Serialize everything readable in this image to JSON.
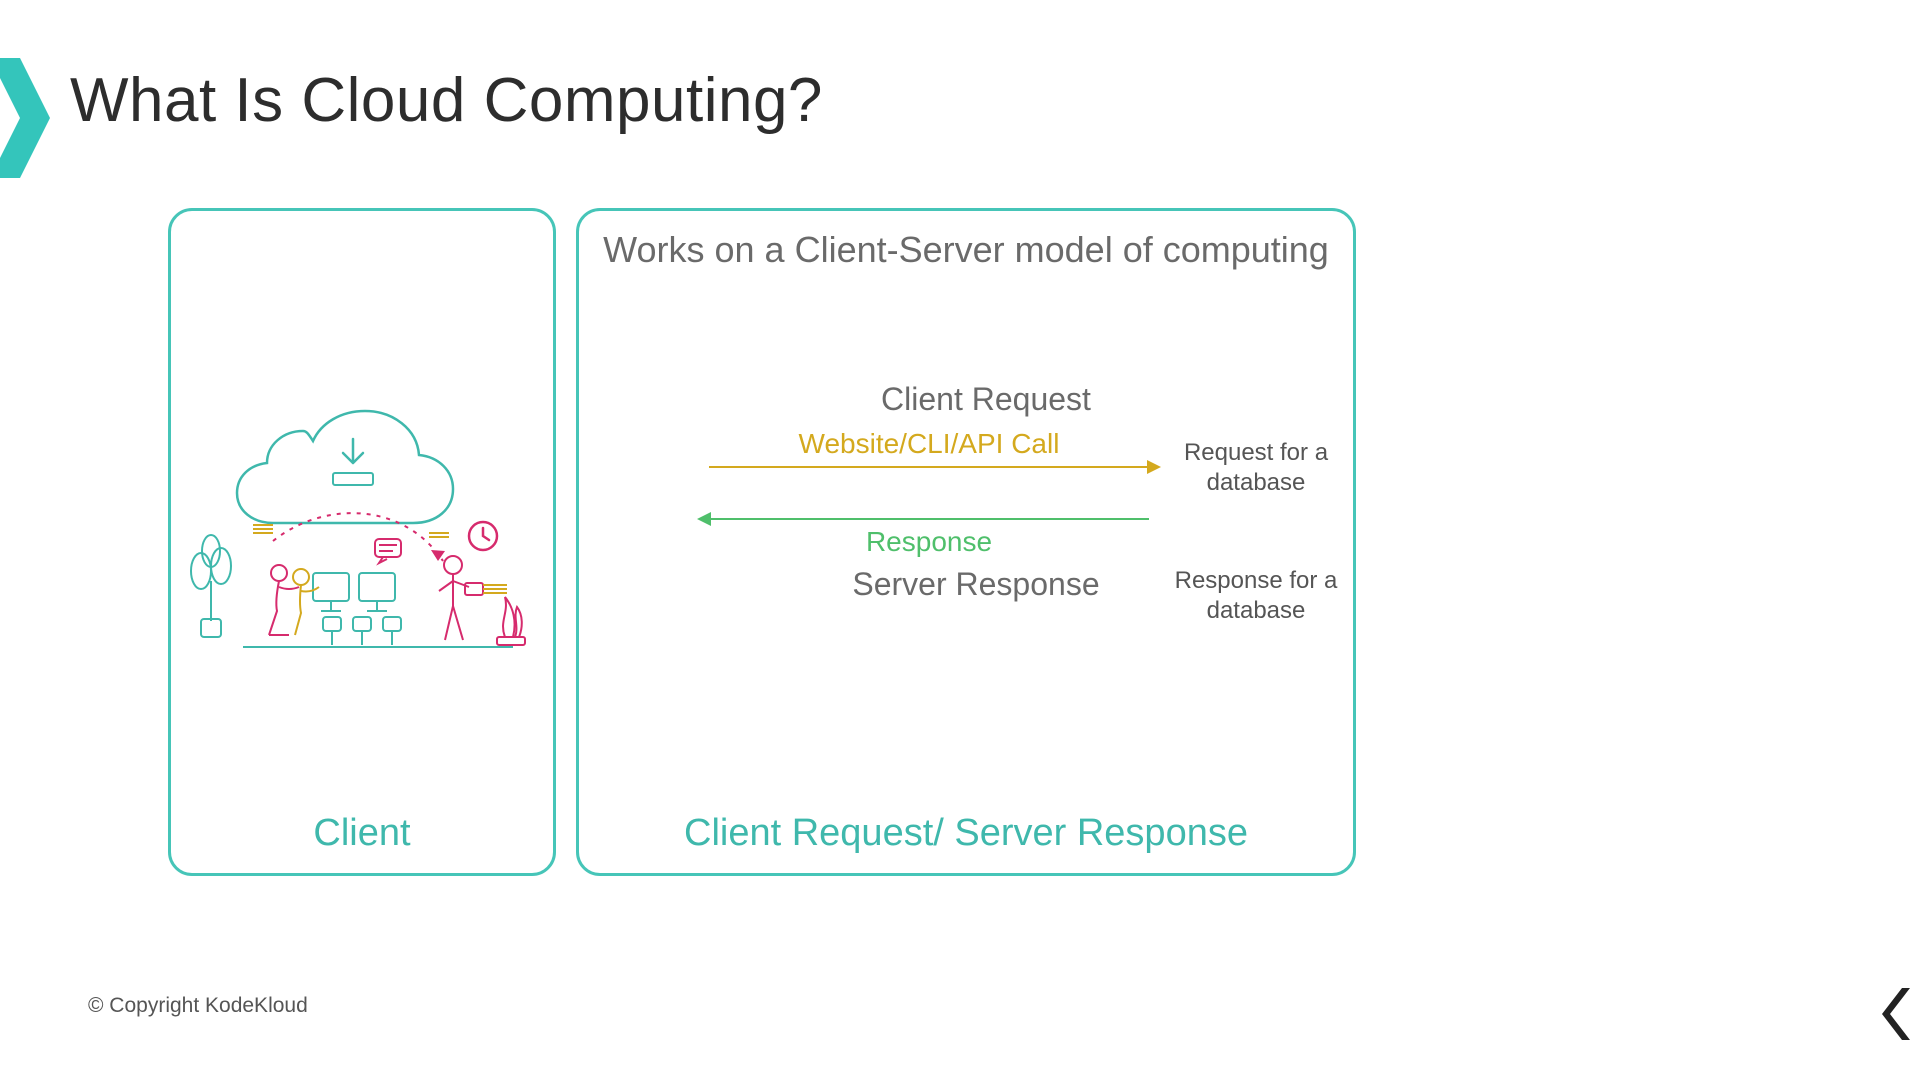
{
  "title": "What Is Cloud Computing?",
  "client_panel": {
    "label": "Client"
  },
  "flow_panel": {
    "heading": "Works on a Client-Server model of computing",
    "client_request_label": "Client Request",
    "server_response_label": "Server Response",
    "request_arrow_caption": "Website/CLI/API Call",
    "response_arrow_caption": "Response",
    "request_note": "Request for a database",
    "response_note": "Response for a database",
    "footer_label": "Client Request/ Server Response"
  },
  "copyright": "© Copyright KodeKloud",
  "colors": {
    "teal": "#46c5b8",
    "teal_text": "#3fb8ac",
    "yellow": "#d4a91e",
    "green": "#4fbf6b",
    "gray_text": "#6a6a6a"
  }
}
